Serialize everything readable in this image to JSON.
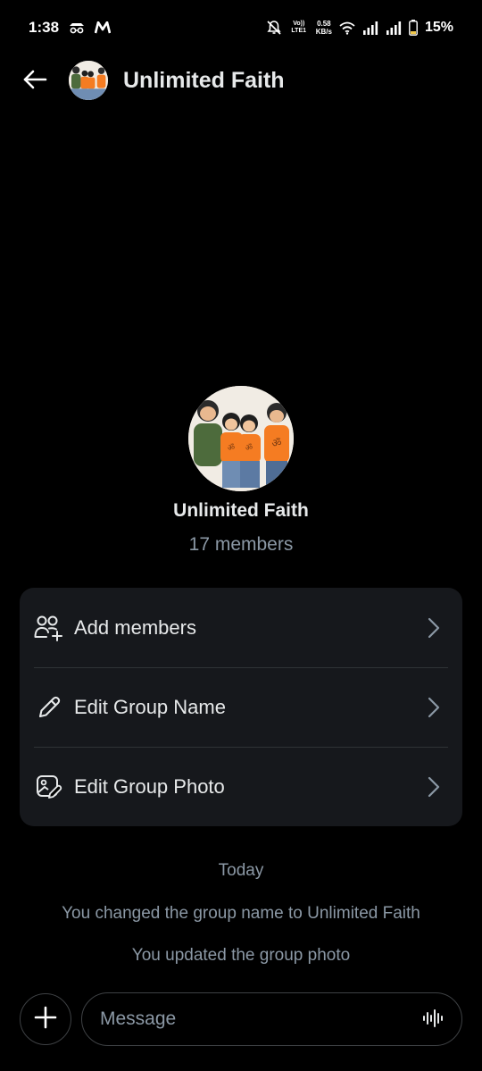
{
  "status_bar": {
    "time": "1:38",
    "net_type": "Vo)) LTE1",
    "speed_value": "0.58",
    "speed_unit": "KB/s",
    "battery": "15%",
    "left_icons": [
      "incognito-icon",
      "m-app-icon"
    ],
    "right_icons": [
      "mute-icon",
      "volte-icon",
      "wifi-icon",
      "signal-icon",
      "signal-icon",
      "battery-icon"
    ]
  },
  "header": {
    "title": "Unlimited Faith",
    "back_icon": "arrow-left-icon"
  },
  "group": {
    "name": "Unlimited Faith",
    "members": "17 members"
  },
  "actions": [
    {
      "label": "Add members",
      "icon": "add-members-icon"
    },
    {
      "label": "Edit Group Name",
      "icon": "pencil-icon"
    },
    {
      "label": "Edit Group Photo",
      "icon": "photo-edit-icon"
    }
  ],
  "timeline": {
    "date": "Today",
    "events": [
      "You changed the group name to Unlimited Faith",
      "You updated the group photo"
    ]
  },
  "composer": {
    "placeholder": "Message",
    "add_icon": "plus-icon",
    "voice_icon": "voice-wave-icon"
  },
  "colors": {
    "background": "#000000",
    "card": "#16181c",
    "text_primary": "#e7e9ea",
    "text_secondary": "#8b98a5",
    "accent_orange": "#f57c22"
  }
}
